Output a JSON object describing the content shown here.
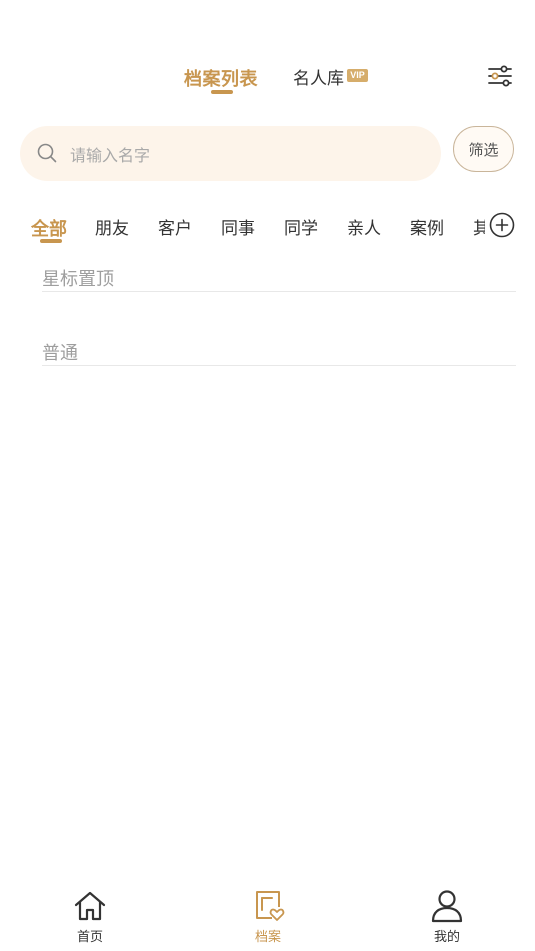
{
  "header": {
    "tab_archive_list": "档案列表",
    "tab_celebrity": "名人库",
    "vip_badge": "VIP"
  },
  "search": {
    "placeholder": "请输入名字",
    "value": "",
    "filter_label": "筛选"
  },
  "categories": {
    "items": [
      "全部",
      "朋友",
      "客户",
      "同事",
      "同学",
      "亲人",
      "案例",
      "其"
    ],
    "active": "全部"
  },
  "sections": {
    "starred": "星标置顶",
    "normal": "普通"
  },
  "bottom_nav": {
    "home": "首页",
    "archive": "档案",
    "mine": "我的",
    "active": "档案"
  },
  "colors": {
    "accent": "#c8964f",
    "search_bg": "#fdf4ea",
    "vip_badge": "#d6ad6b"
  }
}
